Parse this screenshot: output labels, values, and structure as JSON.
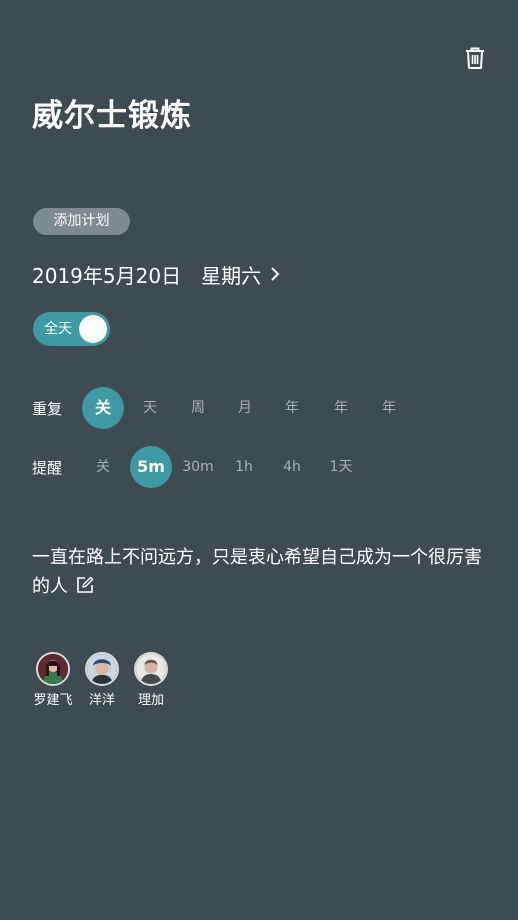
{
  "header": {
    "title": "威尔士锻炼"
  },
  "add_plan_label": "添加计划",
  "date": {
    "text": "2019年5月20日",
    "weekday": "星期六"
  },
  "all_day": {
    "label": "全天",
    "on": true
  },
  "repeat": {
    "label": "重复",
    "options": [
      "关",
      "天",
      "周",
      "月",
      "年",
      "年",
      "年"
    ],
    "selected": "关"
  },
  "reminder": {
    "label": "提醒",
    "options": [
      "关",
      "5m",
      "30m",
      "1h",
      "4h",
      "1天"
    ],
    "selected": "5m"
  },
  "note": {
    "text": "一直在路上不问远方，只是衷心希望自己成为一个很厉害的人"
  },
  "members": [
    {
      "name": "罗建飞"
    },
    {
      "name": "洋洋"
    },
    {
      "name": "理加"
    }
  ],
  "colors": {
    "background": "#3e4b52",
    "accent": "#3e9aa3",
    "chip": "#7d8a90"
  },
  "icons": [
    "trash-icon",
    "chevron-right-icon",
    "edit-icon"
  ]
}
